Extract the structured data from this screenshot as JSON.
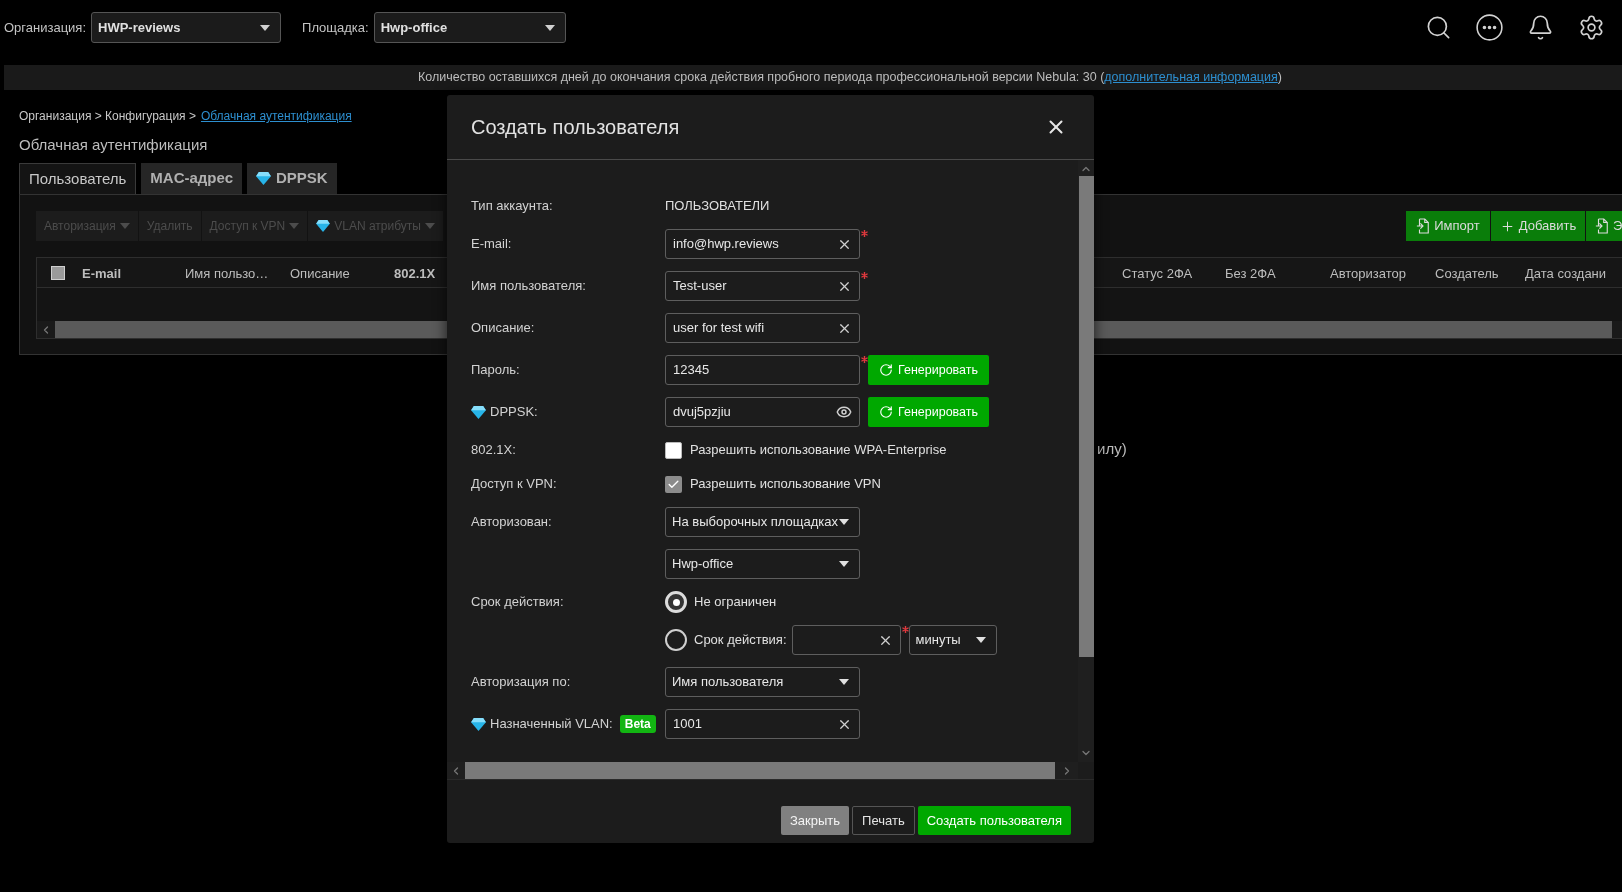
{
  "top_bar": {
    "organization": {
      "label": "Организация:",
      "value": "HWP-reviews"
    },
    "site": {
      "label": "Площадка:",
      "value": "Hwp-office"
    }
  },
  "trial_banner": {
    "text": "Количество оставшихся дней до окончания срока действия пробного периода профессиональной версии Nebula: 30 (",
    "link": "дополнительная информация",
    "closing": ")"
  },
  "breadcrumb": {
    "path": "Организация > Конфигурация >",
    "current": "Облачная аутентификация"
  },
  "page_title": "Облачная аутентификация",
  "tabs": [
    {
      "label": "Пользователь",
      "selected": true,
      "premium": false
    },
    {
      "label": "MAC-адрес",
      "selected": false,
      "premium": false
    },
    {
      "label": "DPPSK",
      "selected": false,
      "premium": true
    }
  ],
  "toolbar": {
    "actions": [
      {
        "label": "Авторизация",
        "dropdown": true,
        "disabled": true,
        "premium": false
      },
      {
        "label": "Удалить",
        "dropdown": false,
        "disabled": true,
        "premium": false
      },
      {
        "label": "Доступ к VPN",
        "dropdown": true,
        "disabled": true,
        "premium": false
      },
      {
        "label": "VLAN атрибуты",
        "dropdown": true,
        "disabled": true,
        "premium": true
      }
    ],
    "buttons": [
      {
        "label": "Импорт",
        "kind": "import"
      },
      {
        "label": "Добавить",
        "kind": "add"
      },
      {
        "label": "Э",
        "kind": "export"
      }
    ]
  },
  "table": {
    "select_all": {
      "checked": false
    },
    "columns": [
      {
        "label": "E-mail",
        "bold": true
      },
      {
        "label": "Имя пользо…",
        "bold": false
      },
      {
        "label": "Описание",
        "bold": false
      },
      {
        "label": "802.1X",
        "bold": true
      },
      {
        "label": "Статус 2ФА",
        "bold": false
      },
      {
        "label": "Без 2ФА",
        "bold": false
      },
      {
        "label": "Авторизатор",
        "bold": false
      },
      {
        "label": "Создатель",
        "bold": false
      },
      {
        "label": "Дата создани",
        "bold": false
      }
    ]
  },
  "background_note": "илу)",
  "dialog": {
    "title": "Создать пользователя",
    "form": [
      {
        "kind": "static",
        "label": "Тип аккаунта:",
        "value": "ПОЛЬЗОВАТЕЛИ",
        "premium": false
      },
      {
        "kind": "input",
        "label": "E-mail:",
        "value": "info@hwp.reviews",
        "required": true,
        "clearable": true,
        "premium": false
      },
      {
        "kind": "input",
        "label": "Имя пользователя:",
        "value": "Test-user",
        "required": true,
        "clearable": true,
        "premium": false
      },
      {
        "kind": "input",
        "label": "Описание:",
        "value": "user for test wifi",
        "required": false,
        "clearable": true,
        "premium": false
      },
      {
        "kind": "input",
        "label": "Пароль:",
        "value": "12345",
        "required": true,
        "clearable": false,
        "generate": "Генерировать",
        "premium": false
      },
      {
        "kind": "input",
        "label": "DPPSK:",
        "value": "dvuj5pzjiu",
        "required": false,
        "clearable": false,
        "reveal": true,
        "generate": "Генерировать",
        "premium": true
      },
      {
        "kind": "checkbox",
        "label": "802.1X:",
        "text": "Разрешить использование WPA-Enterprise",
        "checked": false,
        "premium": false
      },
      {
        "kind": "checkbox",
        "label": "Доступ к VPN:",
        "text": "Разрешить использование VPN",
        "checked": true,
        "premium": false
      },
      {
        "kind": "select",
        "label": "Авторизован:",
        "value": "На выборочных площадках",
        "premium": false
      },
      {
        "kind": "select",
        "value": "Hwp-office",
        "premium": false
      },
      {
        "kind": "radio",
        "label": "Срок действия:",
        "premium": false,
        "options": [
          {
            "label": "Не ограничен",
            "selected": true
          },
          {
            "label": "Срок действия:",
            "selected": false,
            "duration": {
              "required": true,
              "clearable": true
            },
            "unit": "минуты"
          }
        ]
      },
      {
        "kind": "select",
        "label": "Авторизация по:",
        "value": "Имя пользователя",
        "premium": false
      },
      {
        "kind": "input",
        "label": "Назначенный VLAN:",
        "value": "1001",
        "required": false,
        "clearable": true,
        "premium": true,
        "badge": "Beta"
      }
    ],
    "buttons": [
      {
        "label": "Закрыть",
        "kind": "secondary"
      },
      {
        "label": "Печать",
        "kind": "default"
      },
      {
        "label": "Создать пользователя",
        "kind": "primary"
      }
    ]
  }
}
